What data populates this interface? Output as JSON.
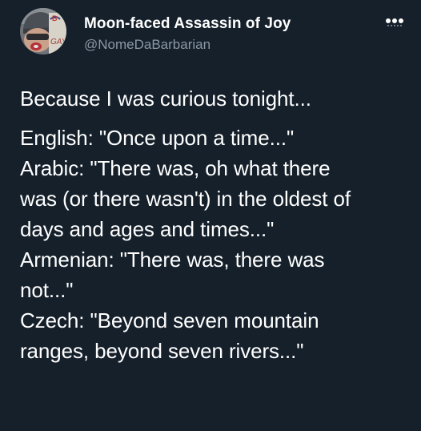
{
  "theme": {
    "background": "#15202b",
    "text": "#ffffff",
    "secondary_text": "#8b98a5"
  },
  "author": {
    "display_name": "Moon-faced Assassin of Joy",
    "handle": "@NomeDaBarbarian",
    "avatar_icon": "user-avatar-icon",
    "avatar_sign_text": "GAY"
  },
  "menu": {
    "icon": "more-horizontal-icon"
  },
  "tweet": {
    "intro": "Because I was curious tonight...",
    "lines": [
      "English: \"Once upon a time...\"",
      "Arabic: \"There was, oh what there",
      "was (or there wasn't) in the oldest of",
      "days and ages and times...\"",
      "Armenian: \"There was, there was",
      "not...\"",
      "Czech: \"Beyond seven mountain",
      "ranges, beyond seven rivers...\""
    ]
  }
}
